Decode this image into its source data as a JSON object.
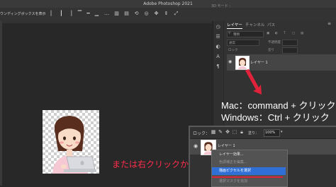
{
  "app": {
    "title": "Adobe Photoshop 2021"
  },
  "options_bar": {
    "bounding_box_label": "ウンディングボックスを表示",
    "mode_3d_label": "3D モード :"
  },
  "layers_panel": {
    "tabs": [
      {
        "label": "レイヤー",
        "active": true
      },
      {
        "label": "チャンネル",
        "active": false
      },
      {
        "label": "パス",
        "active": false
      }
    ],
    "kind_filter": "種類",
    "blend_mode": "通常",
    "opacity_label": "不透明度",
    "lock_label": "ロック",
    "fill_label": "塗り",
    "layer_name": "レイヤー 1"
  },
  "annotations": {
    "mac": "Mac：command + クリック",
    "windows": "Windows：Ctrl + クリック",
    "right_click": "または右クリックから"
  },
  "inset": {
    "lock_label": "ロック：",
    "fill_label": "塗り：",
    "fill_value": "100%",
    "layer_name": "レイヤー 1",
    "context_menu": [
      {
        "label": "レイヤー効果...",
        "state": "normal"
      },
      {
        "label": "色調補正を編集...",
        "state": "disabled"
      },
      {
        "label": "描画ピクセルを選択",
        "state": "highlighted"
      },
      {
        "label": "選択マスクを追加",
        "state": "disabled"
      }
    ]
  },
  "colors": {
    "accent_red": "#ff2d4a",
    "menu_highlight": "#2f6fd6",
    "canvas_bg": "#282828"
  }
}
